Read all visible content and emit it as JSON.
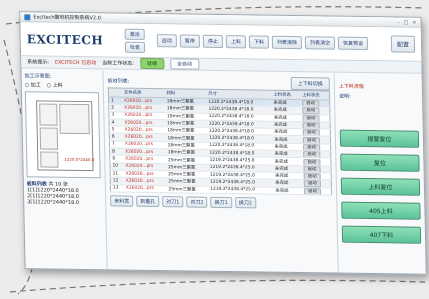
{
  "window": {
    "title": "Excitech雕刻机控制系统V2.0"
  },
  "header": {
    "logo": "EXCITECH",
    "center_buttons": [
      "激活",
      "检查"
    ],
    "toolbar": [
      "启动",
      "暂停",
      "停止",
      "上料",
      "下料",
      "列表清除",
      "列表清空",
      "恢复预设"
    ],
    "config_label": "配置"
  },
  "status": {
    "left_text": "系统提示:",
    "red_text": "EXCITECH 已启动",
    "mid_text": "当前工作状态:",
    "green_pill": "就绪",
    "white_pill": "全自动"
  },
  "left": {
    "label": "加工示意图:",
    "radio1": "加工",
    "radio2": "上料",
    "sheet_dim": "1220.0*2440.0",
    "count_label": "板料列表",
    "count_value": "共 10 张",
    "notes": [
      "1[1]1220*2440*18.0",
      "2[1]1220*2440*18.0",
      "3[1]1220*2440*18.0"
    ]
  },
  "center": {
    "title": "板材列表:",
    "switch_button": "上下料切换",
    "columns": [
      "",
      "文件名称",
      "材料",
      "尺寸",
      "上料状态",
      "上料状态"
    ],
    "rows": [
      {
        "no": "1",
        "file": "X26020...prs",
        "material": "18mm三聚氰",
        "size": "1220.2*2438.4*18.0",
        "s1": "未完成",
        "s2": "启动"
      },
      {
        "no": "2",
        "file": "X26020...prs",
        "material": "18mm三聚氰",
        "size": "1220.2*2438.4*18.0",
        "s1": "未完成",
        "s2": "启动"
      },
      {
        "no": "3",
        "file": "X26020...prs",
        "material": "18mm三聚氰",
        "size": "1220.2*2438.4*18.0",
        "s1": "未完成",
        "s2": "启动"
      },
      {
        "no": "4",
        "file": "X26020...prs",
        "material": "18mm三聚氰",
        "size": "1220.2*2438.4*18.0",
        "s1": "未完成",
        "s2": "启动"
      },
      {
        "no": "5",
        "file": "X26020...prs",
        "material": "18mm三聚氰",
        "size": "1220.2*2438.4*18.0",
        "s1": "未完成",
        "s2": "启动"
      },
      {
        "no": "6",
        "file": "X26020...prs",
        "material": "18mm三聚氰",
        "size": "1220.2*2438.4*18.0",
        "s1": "未完成",
        "s2": "启动"
      },
      {
        "no": "7",
        "file": "X26020...prs",
        "material": "18mm三聚氰",
        "size": "1220.2*2438.4*18.0",
        "s1": "未完成",
        "s2": "启动"
      },
      {
        "no": "8",
        "file": "X26020...prs",
        "material": "18mm三聚氰",
        "size": "1220.2*2438.4*18.0",
        "s1": "未完成",
        "s2": "启动"
      },
      {
        "no": "9",
        "file": "X26020...prs",
        "material": "25mm三聚氰",
        "size": "1219.2*2438.4*25.0",
        "s1": "未完成",
        "s2": "启动"
      },
      {
        "no": "10",
        "file": "X26020...prs",
        "material": "25mm三聚氰",
        "size": "1219.2*2438.4*25.0",
        "s1": "未完成",
        "s2": "启动"
      },
      {
        "no": "11",
        "file": "X26020...prs",
        "material": "25mm三聚氰",
        "size": "1219.2*2438.4*25.0",
        "s1": "未完成",
        "s2": "启动"
      },
      {
        "no": "12",
        "file": "X26020...prs",
        "material": "25mm三聚氰",
        "size": "1219.2*2438.4*25.0",
        "s1": "未完成",
        "s2": "启动"
      },
      {
        "no": "13",
        "file": "X26020...prs",
        "material": "25mm三聚氰",
        "size": "1219.2*2438.4*25.0",
        "s1": "未完成",
        "s2": "启动"
      }
    ],
    "tabs": [
      "来料宽",
      "到量孔",
      "对刀1",
      "对刀2",
      "换刀1",
      "换刀2"
    ]
  },
  "right": {
    "title": "上下料流程",
    "label": "说明:",
    "buttons": [
      "报警复位",
      "复位",
      "上料复位",
      "405上料",
      "407下料"
    ]
  }
}
